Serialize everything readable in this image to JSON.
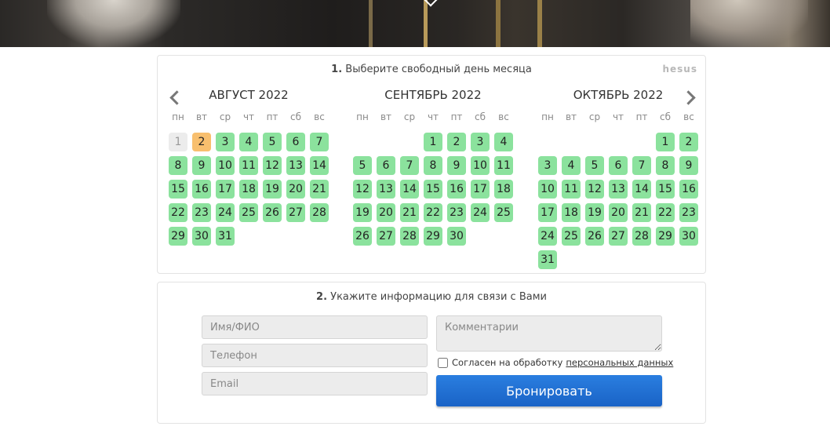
{
  "booking": {
    "brand": "hesus",
    "step1": {
      "number": "1.",
      "text": " Выберите свободный день месяца"
    },
    "weekdays": [
      "пн",
      "вт",
      "ср",
      "чт",
      "пт",
      "сб",
      "вс"
    ],
    "months": [
      {
        "title": "АВГУСТ 2022",
        "offset": 0,
        "days": 31,
        "past": [
          1
        ],
        "today": 2
      },
      {
        "title": "СЕНТЯБРЬ 2022",
        "offset": 3,
        "days": 30,
        "past": [],
        "today": null
      },
      {
        "title": "ОКТЯБРЬ 2022",
        "offset": 5,
        "days": 31,
        "past": [],
        "today": null
      }
    ],
    "colors": {
      "available": "#8be29d",
      "today": "#f8bf6e",
      "past": "#ececec",
      "button": "#1f6fd4"
    }
  },
  "contact": {
    "step2": {
      "number": "2.",
      "text": " Укажите информацию для связи с Вами"
    },
    "name_placeholder": "Имя/ФИО",
    "phone_placeholder": "Телефон",
    "email_placeholder": "Email",
    "comment_placeholder": "Комментарии",
    "consent_text": "Согласен на обработку",
    "consent_link": "персональных данных",
    "submit_label": "Бронировать"
  }
}
